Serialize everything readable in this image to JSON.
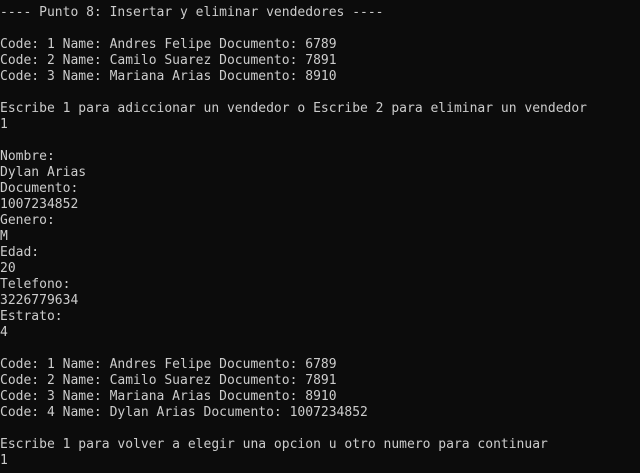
{
  "console": {
    "header": "---- Punto 8: Insertar y eliminar vendedores ----",
    "initial_list": [
      "Code: 1 Name: Andres Felipe Documento: 6789",
      "Code: 2 Name: Camilo Suarez Documento: 7891",
      "Code: 3 Name: Mariana Arias Documento: 8910"
    ],
    "menu_prompt": "Escribe 1 para adiccionar un vendedor o Escribe 2 para eliminar un vendedor",
    "menu_input": "1",
    "form": [
      {
        "label": "Nombre:",
        "value": "Dylan Arias"
      },
      {
        "label": "Documento:",
        "value": "1007234852"
      },
      {
        "label": "Genero:",
        "value": "M"
      },
      {
        "label": "Edad:",
        "value": "20"
      },
      {
        "label": "Telefono:",
        "value": "3226779634"
      },
      {
        "label": "Estrato:",
        "value": "4"
      }
    ],
    "updated_list": [
      "Code: 1 Name: Andres Felipe Documento: 6789",
      "Code: 2 Name: Camilo Suarez Documento: 7891",
      "Code: 3 Name: Mariana Arias Documento: 8910",
      "Code: 4 Name: Dylan Arias Documento: 1007234852"
    ],
    "continue_prompt": "Escribe 1 para volver a elegir una opcion u otro numero para continuar",
    "continue_input": "1"
  },
  "colors": {
    "background": "#0c0c0c",
    "text": "#cccccc"
  }
}
